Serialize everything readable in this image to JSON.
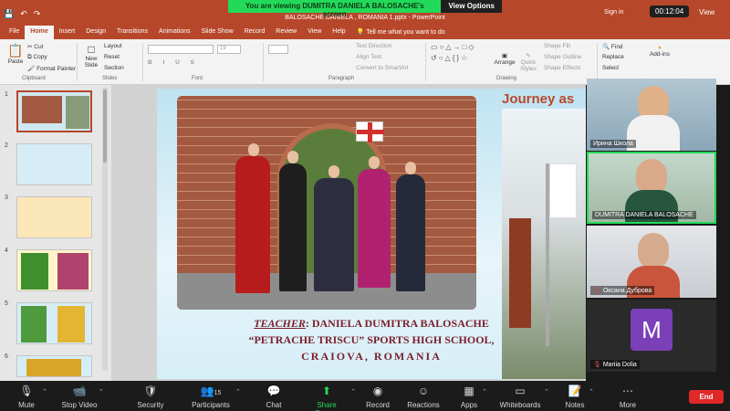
{
  "titlebar": {
    "qa_icons": [
      "save-icon",
      "undo-icon",
      "redo-icon"
    ],
    "document_title": "BALOSACHE DANIELA , ROMANIA 1.pptx - PowerPoint",
    "sign_in": "Sign in",
    "view": "View"
  },
  "share_banner": {
    "message": "You are viewing DUMITRA DANIELA BALOSACHE's screen",
    "view_options": "View Options"
  },
  "timer": "00:12:04",
  "tabs": [
    "File",
    "Home",
    "Insert",
    "Design",
    "Transitions",
    "Animations",
    "Slide Show",
    "Record",
    "Review",
    "View",
    "Help"
  ],
  "active_tab": "Home",
  "tell_me": "Tell me what you want to do",
  "ribbon": {
    "clipboard": {
      "paste": "Paste",
      "cut": "Cut",
      "copy": "Copy",
      "format_painter": "Format Painter",
      "label": "Clipboard"
    },
    "slides": {
      "new_slide": "New Slide",
      "layout": "Layout",
      "reset": "Reset",
      "section": "Section",
      "label": "Slides"
    },
    "font": {
      "size": "19",
      "label": "Font"
    },
    "paragraph": {
      "text_direction": "Text Direction",
      "align_text": "Align Text",
      "convert_smartart": "Convert to SmartArt",
      "label": "Paragraph"
    },
    "drawing": {
      "arrange": "Arrange",
      "quick_styles": "Quick Styles",
      "shape_fill": "Shape Fill",
      "shape_outline": "Shape Outline",
      "shape_effects": "Shape Effects",
      "label": "Drawing"
    },
    "editing": {
      "find": "Find",
      "replace": "Replace",
      "select": "Select"
    },
    "addins": "Add-ins"
  },
  "slide_numbers": [
    "1",
    "2",
    "3",
    "4",
    "5",
    "6"
  ],
  "slide": {
    "teacher_label": "TEACHER",
    "teacher_name": ": DANIELA DUMITRA BALOSACHE",
    "school": "“PETRACHE TRISCU” SPORTS HIGH SCHOOL,",
    "city": "CRAIOVA, ROMANIA",
    "journey": "Journey as"
  },
  "participants": [
    {
      "name": "Ирина Школа",
      "muted": false
    },
    {
      "name": "DUMITRA DANIELA BALOSACHE",
      "muted": false,
      "active": true
    },
    {
      "name": "Оксана Дуброва",
      "muted": true
    },
    {
      "name": "Mariia Dolia",
      "muted": true,
      "initial": "M"
    }
  ],
  "zoom_bar": {
    "mute": "Mute",
    "stop_video": "Stop Video",
    "security": "Security",
    "participants": "Participants",
    "participants_count": "15",
    "chat": "Chat",
    "share_screen": "Share Screen",
    "record": "Record",
    "reactions": "Reactions",
    "apps": "Apps",
    "whiteboards": "Whiteboards",
    "notes": "Notes",
    "more": "More",
    "end": "End"
  },
  "colors": {
    "ppt_accent": "#b7472a",
    "zoom_green": "#23d959",
    "end_red": "#e02828"
  }
}
